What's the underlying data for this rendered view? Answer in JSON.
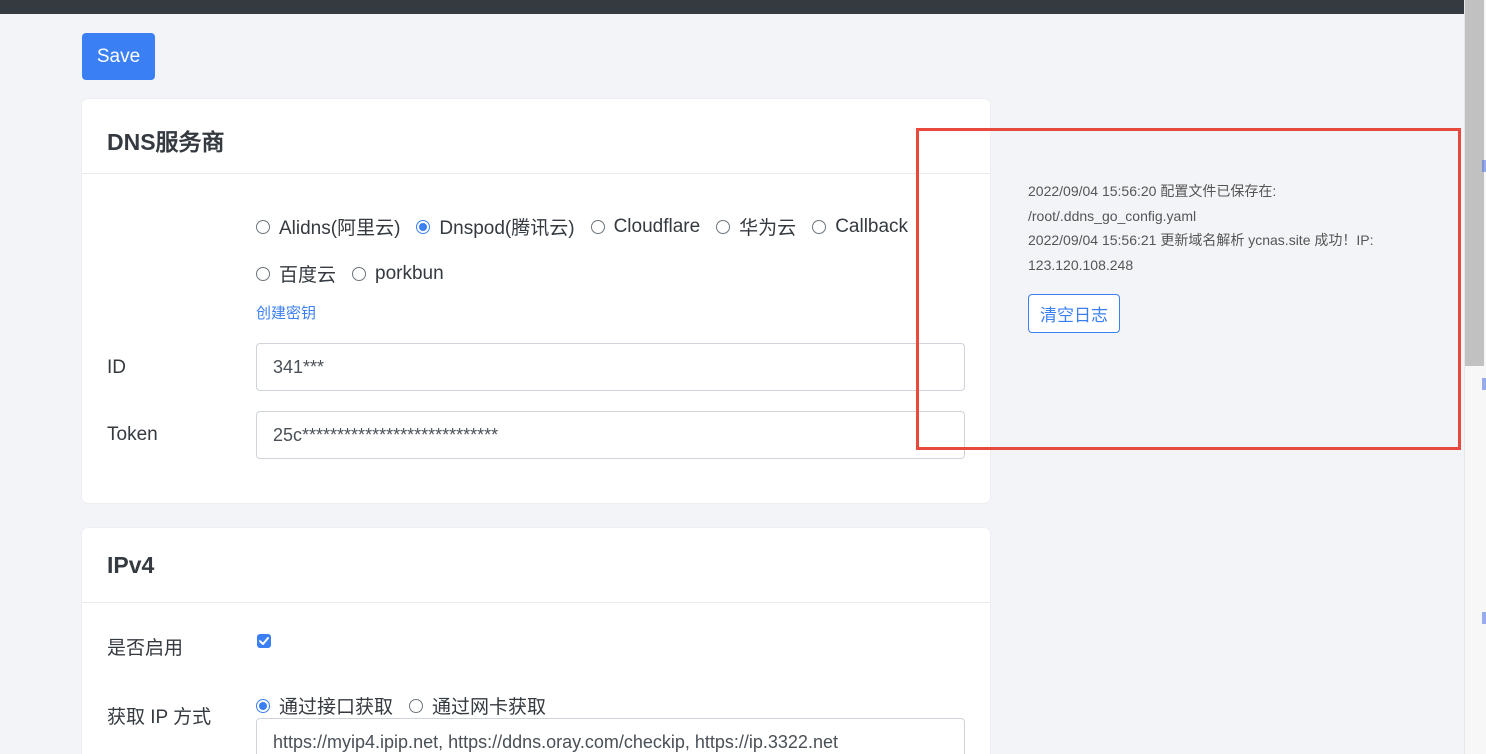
{
  "toolbar": {
    "save_label": "Save"
  },
  "dns": {
    "title": "DNS服务商",
    "providers": [
      {
        "label": "Alidns(阿里云)",
        "checked": false
      },
      {
        "label": "Dnspod(腾讯云)",
        "checked": true
      },
      {
        "label": "Cloudflare",
        "checked": false
      },
      {
        "label": "华为云",
        "checked": false
      },
      {
        "label": "Callback",
        "checked": false
      },
      {
        "label": "百度云",
        "checked": false
      },
      {
        "label": "porkbun",
        "checked": false
      }
    ],
    "create_key_link": "创建密钥",
    "id_label": "ID",
    "id_value": "341***",
    "token_label": "Token",
    "token_value": "25c****************************"
  },
  "ipv4": {
    "title": "IPv4",
    "enable_label": "是否启用",
    "enabled": true,
    "method_label": "获取 IP 方式",
    "methods": [
      {
        "label": "通过接口获取",
        "checked": true
      },
      {
        "label": "通过网卡获取",
        "checked": false
      }
    ],
    "url_value": "https://myip4.ipip.net, https://ddns.oray.com/checkip, https://ip.3322.net"
  },
  "log": {
    "lines": [
      "2022/09/04 15:56:20 配置文件已保存在:",
      "/root/.ddns_go_config.yaml",
      "2022/09/04 15:56:21 更新域名解析 ycnas.site 成功！IP:",
      "123.120.108.248"
    ],
    "clear_label": "清空日志"
  },
  "colors": {
    "accent": "#3b7ff5",
    "highlight_box": "#e8493d",
    "topbar": "#343a40"
  }
}
